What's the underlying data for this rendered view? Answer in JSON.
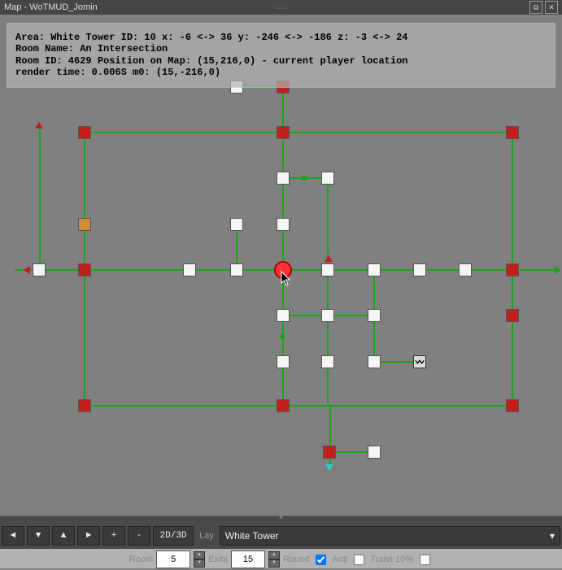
{
  "titlebar": {
    "title": "Map - WoTMUD_Jomin"
  },
  "info": {
    "line1": "Area: White Tower ID: 10 x: -6 <-> 36 y: -246 <-> -186 z: -3 <-> 24",
    "line2": "Room Name: An Intersection",
    "line3": "Room ID: 4629 Position on Map: (15,216,0) - current player location",
    "line4": "render time: 0.006S m0: (15,-216,0)"
  },
  "toolbar": {
    "left": "◄",
    "down": "▼",
    "up": "▲",
    "right": "►",
    "plus": "+",
    "minus": "-",
    "mode": "2D/3D",
    "layer_lbl": "Lay",
    "area": "White Tower",
    "area_chevron": "▾"
  },
  "subbar": {
    "room_lbl": "Room",
    "room_val": "5",
    "exits_lbl": "Exits",
    "exits_val": "15",
    "round_lbl": "Round",
    "round_checked": true,
    "anti_lbl": "Anti",
    "anti_checked": false,
    "trans_lbl": "Trans 10%",
    "trans_checked": false
  }
}
